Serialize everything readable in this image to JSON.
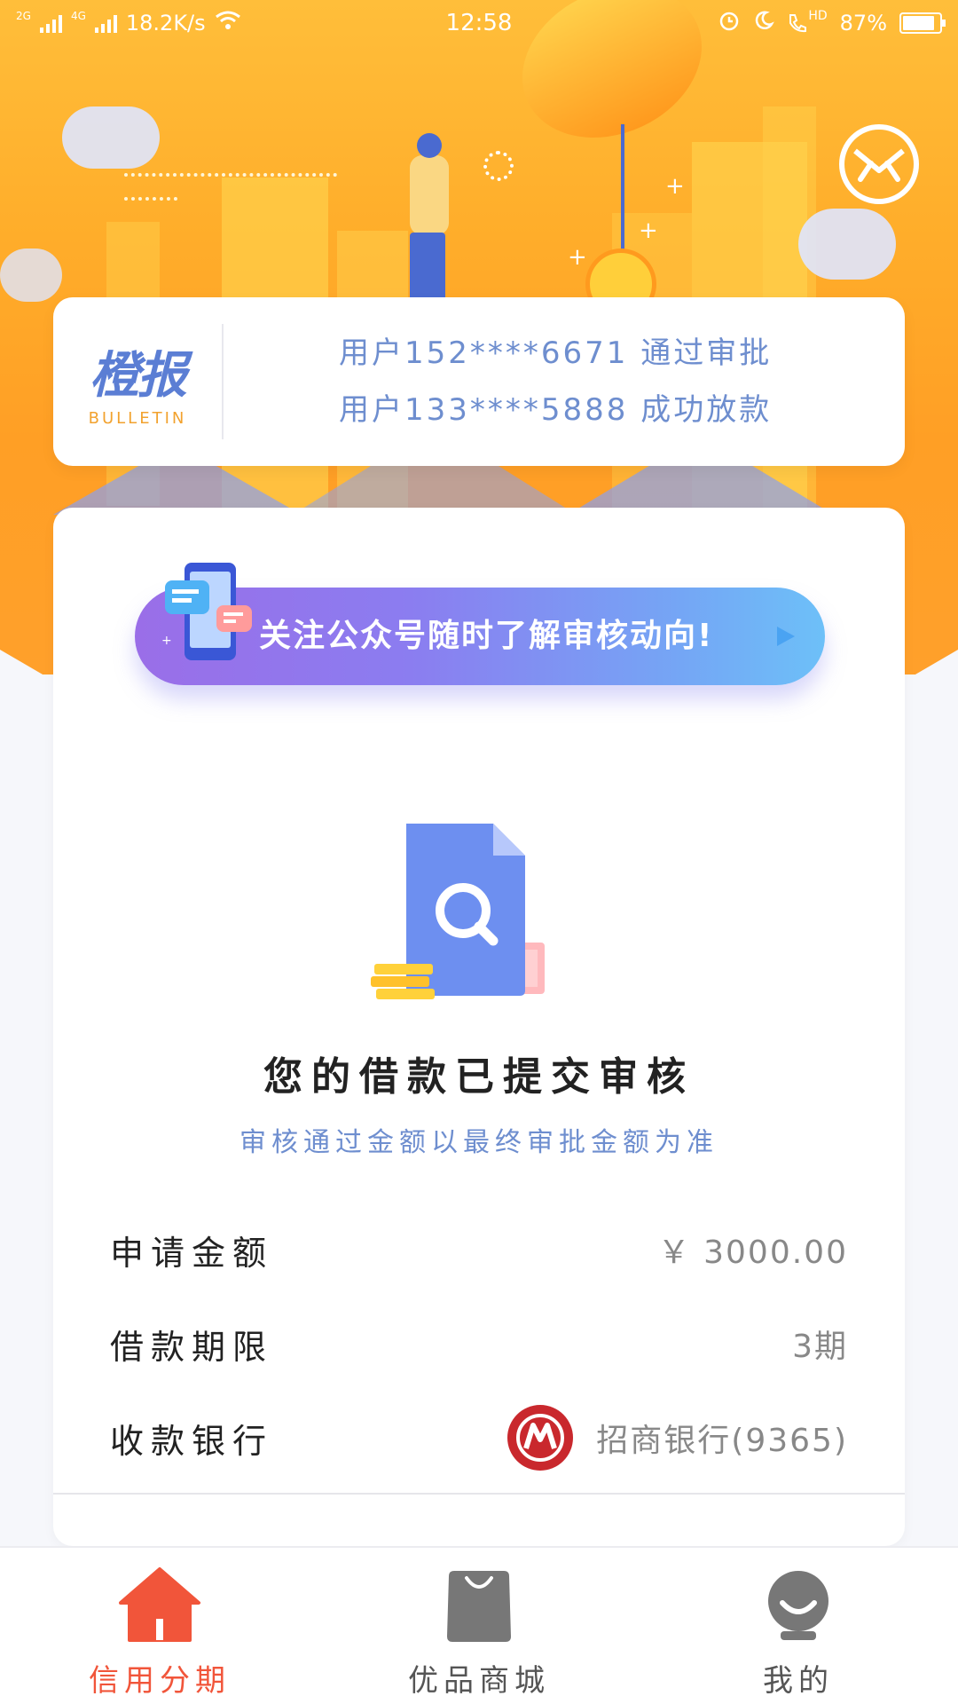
{
  "status_bar": {
    "signal1": "2G",
    "signal2": "4G",
    "speed": "18.2K/s",
    "time": "12:58",
    "hd": "HD",
    "battery": "87%",
    "battery_level": 0.87
  },
  "bulletin": {
    "logo_cn": "橙报",
    "logo_en": "BULLETIN",
    "lines": [
      "用户152****6671 通过审批",
      "用户133****5888 成功放款"
    ]
  },
  "promo": {
    "text": "关注公众号随时了解审核动向!"
  },
  "status": {
    "title": "您的借款已提交审核",
    "subtitle": "审核通过金额以最终审批金额为准"
  },
  "details": [
    {
      "label": "申请金额",
      "value": "￥ 3000.00"
    },
    {
      "label": "借款期限",
      "value": "3期"
    },
    {
      "label": "收款银行",
      "value": "招商银行(9365)",
      "icon": "cmb-bank-logo"
    }
  ],
  "nav": [
    {
      "label": "信用分期",
      "icon": "home-icon",
      "active": true
    },
    {
      "label": "优品商城",
      "icon": "shopping-bag-icon",
      "active": false
    },
    {
      "label": "我的",
      "icon": "profile-icon",
      "active": false
    }
  ],
  "colors": {
    "hero": "#ffad2a",
    "accent_blue": "#6e8ecf",
    "nav_active": "#f1553a",
    "bank_red": "#c9282d"
  }
}
